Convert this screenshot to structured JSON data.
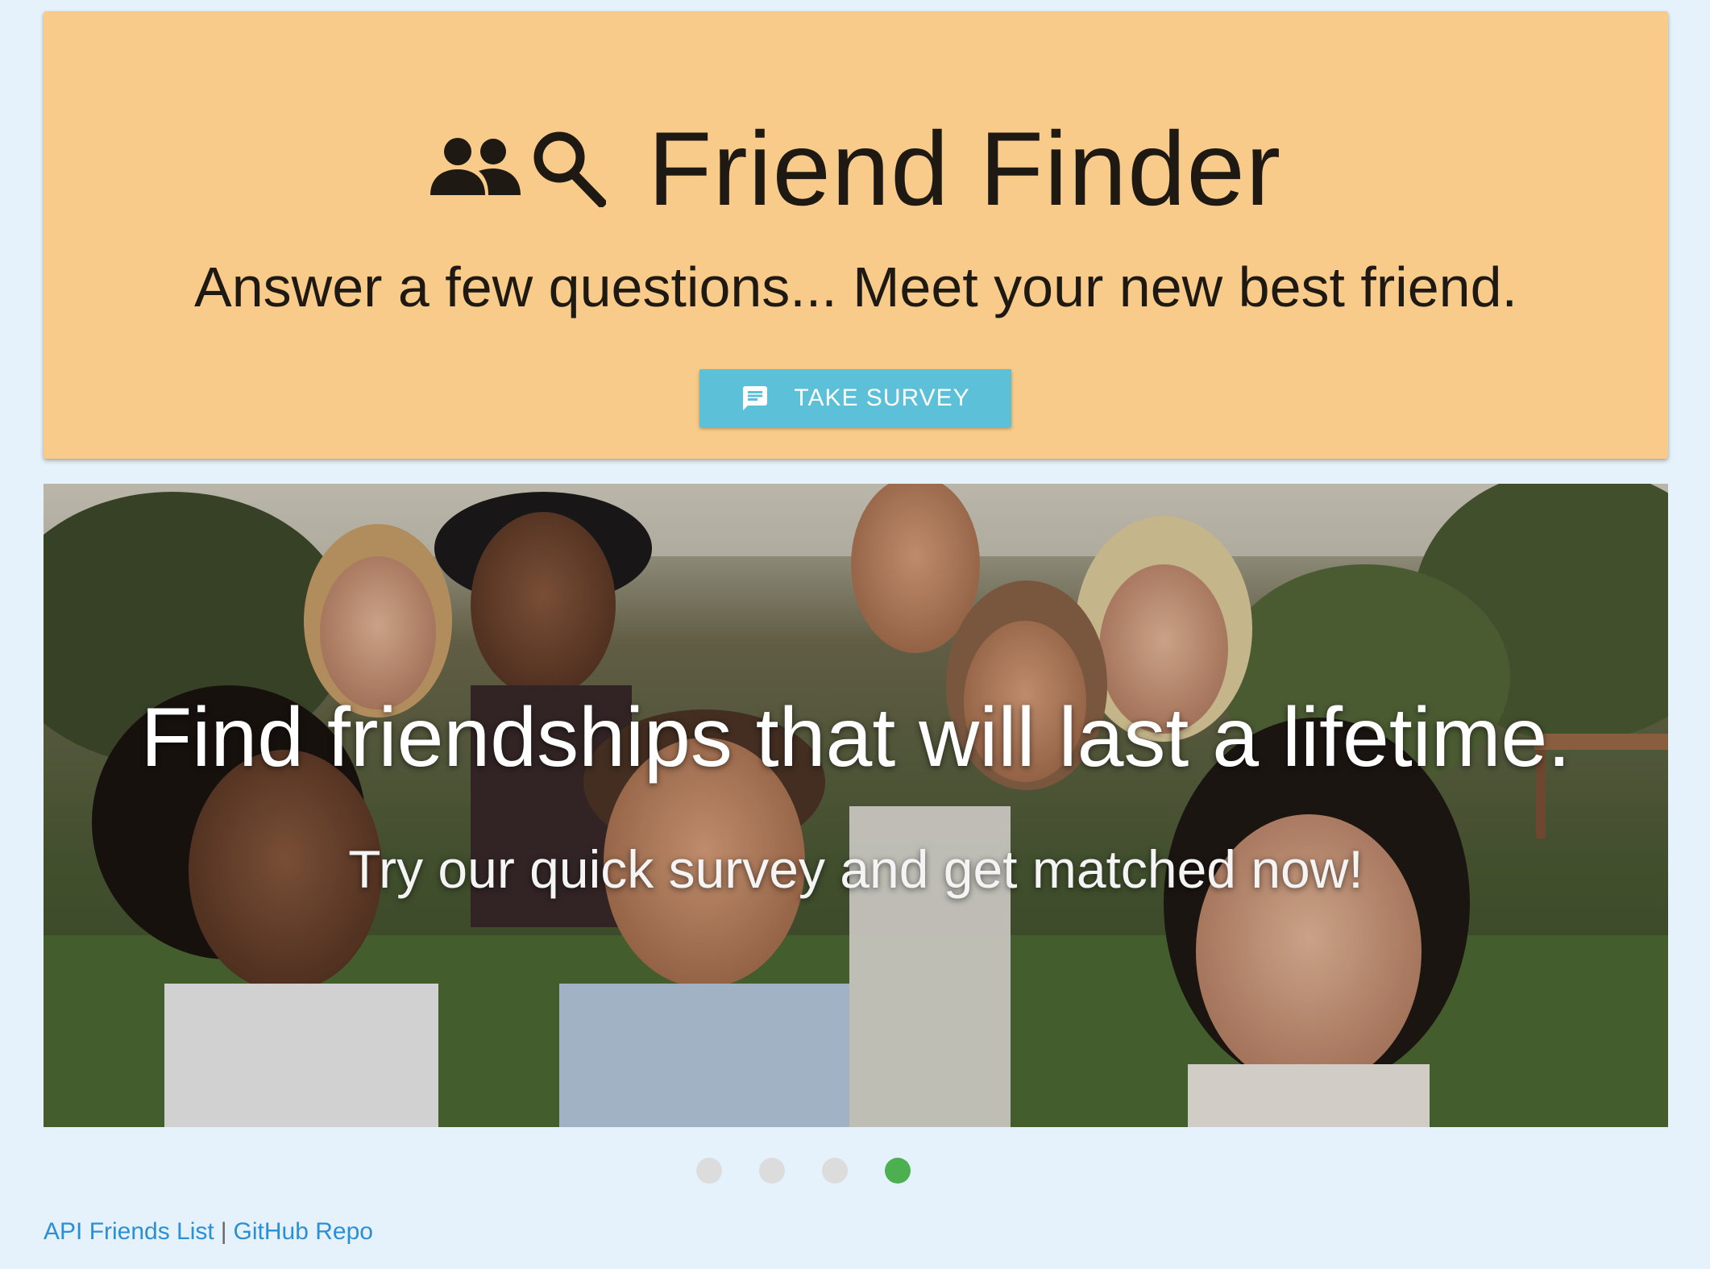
{
  "header": {
    "title": "Friend Finder",
    "icons": [
      "people-icon",
      "search-icon"
    ],
    "tagline": "Answer a few questions... Meet your new best friend.",
    "survey_button": {
      "icon": "chat-bubble-icon",
      "label": "TAKE SURVEY"
    }
  },
  "carousel": {
    "title": "Find friendships that will last a lifetime.",
    "subtitle": "Try our quick survey and get matched now!",
    "slide_count": 4,
    "active_slide": 4
  },
  "footer": {
    "links": [
      {
        "label": "API Friends List"
      },
      {
        "label": "GitHub Repo"
      }
    ],
    "separator": "|"
  },
  "colors": {
    "page_background": "#e6f2fb",
    "card_background": "#f8cb8a",
    "button_background": "#5bc0d8",
    "active_dot": "#4caf50",
    "inactive_dot": "#dcdcdc",
    "link": "#2b8fd6"
  }
}
